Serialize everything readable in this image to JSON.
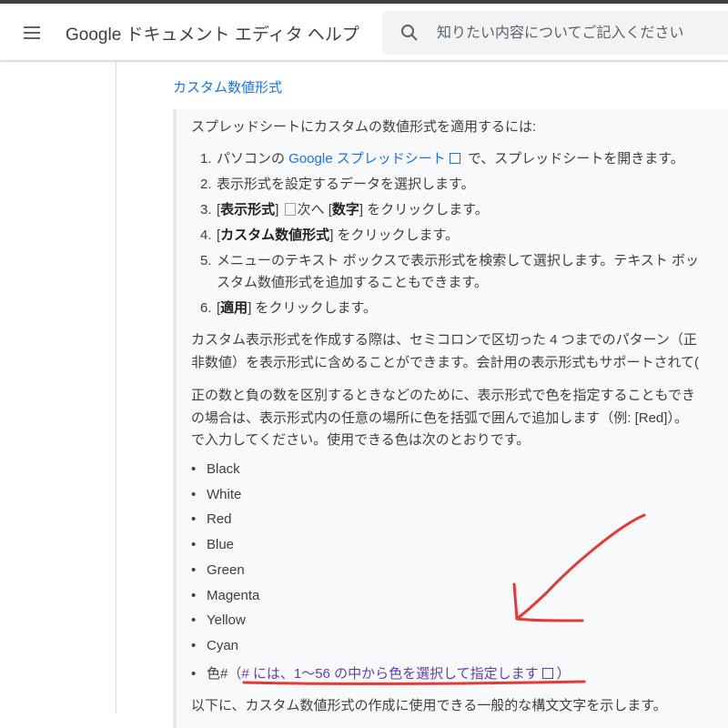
{
  "header": {
    "title": "Google ドキュメント エディタ ヘルプ",
    "search_placeholder": "知りたい内容についてご記入ください"
  },
  "section_link": "カスタム数値形式",
  "intro": "スプレッドシートにカスタムの数値形式を適用するには:",
  "steps": [
    {
      "num": "1.",
      "a": "パソコンの ",
      "link": "Google スプレッドシート",
      "b": " で、スプレッドシートを開きます。"
    },
    {
      "num": "2.",
      "text": "表示形式を設定するデータを選択します。"
    },
    {
      "num": "3.",
      "a": "[",
      "bold1": "表示形式",
      "b": "] ",
      "img_alt": "次へ",
      "c": " [",
      "bold2": "数字",
      "d": "] をクリックします。"
    },
    {
      "num": "4.",
      "a": "[",
      "bold1": "カスタム数値形式",
      "b": "] をクリックします。"
    },
    {
      "num": "5.",
      "line1": "メニューのテキスト ボックスで表示形式を検索して選択します。テキスト ボッ",
      "line2": "スタム数値形式を追加することもできます。"
    },
    {
      "num": "6.",
      "a": "[",
      "bold1": "適用",
      "b": "] をクリックします。"
    }
  ],
  "para1": {
    "line1": "カスタム表示形式を作成する際は、セミコロンで区切った 4 つまでのパターン（正",
    "line2": "非数値）を表示形式に含めることができます。会計用の表示形式もサポートされて("
  },
  "para2": {
    "line1": "正の数と負の数を区別するときなどのために、表示形式で色を指定することもでき",
    "line2": "の場合は、表示形式内の任意の場所に色を括弧で囲んで追加します（例: [Red]）。",
    "line3": "で入力してください。使用できる色は次のとおりです。"
  },
  "bullet_char": "•",
  "colors": [
    "Black",
    "White",
    "Red",
    "Blue",
    "Green",
    "Magenta",
    "Yellow",
    "Cyan"
  ],
  "color_hash": {
    "prefix": "色#",
    "paren_open": "（",
    "link": "# には、1〜56 の中から色を選択して指定します",
    "paren_close": "）"
  },
  "footer_text": "以下に、カスタム数値形式の作成に使用できる一般的な構文文字を示します。",
  "accent_colors": {
    "link": "#1a73e8",
    "annotation": "#e53935"
  }
}
